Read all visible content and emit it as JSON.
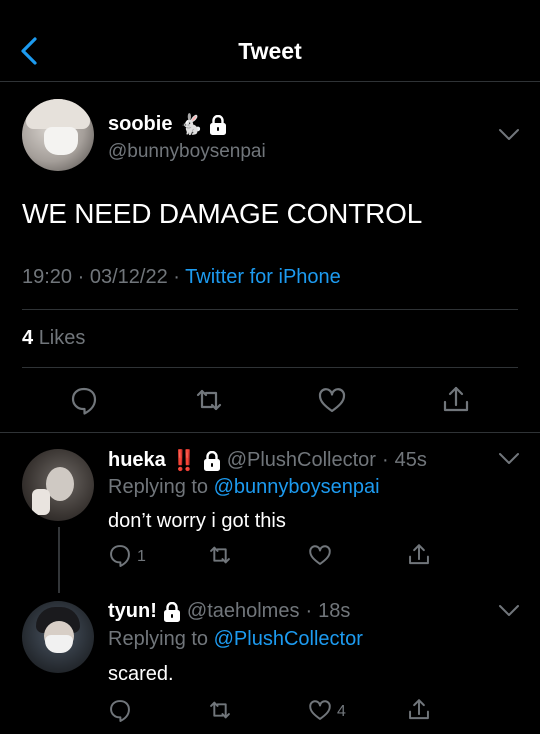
{
  "header": {
    "title": "Tweet"
  },
  "main_tweet": {
    "name": "soobie",
    "name_emoji": "🐇",
    "handle": "@bunnyboysenpai",
    "text": "WE NEED DAMAGE CONTROL",
    "time": "19:20",
    "date": "03/12/22",
    "separator": "·",
    "source": "Twitter for iPhone",
    "likes_count": "4",
    "likes_label": "Likes"
  },
  "replies": [
    {
      "name": "hueka",
      "name_emoji": "‼️",
      "handle": "@PlushCollector",
      "time": "45s",
      "separator": "·",
      "replying_prefix": "Replying to",
      "replying_to": "@bunnyboysenpai",
      "text": "don’t worry i got this",
      "reply_count": "1",
      "like_count": ""
    },
    {
      "name": "tyun!",
      "name_emoji": "",
      "handle": "@taeholmes",
      "time": "18s",
      "separator": "·",
      "replying_prefix": "Replying to",
      "replying_to": "@PlushCollector",
      "text": "scared.",
      "reply_count": "",
      "like_count": "4"
    }
  ],
  "icons": {
    "back": "chevron-left-icon",
    "lock": "lock-icon",
    "reply": "speech-bubble-icon",
    "retweet": "retweet-icon",
    "like": "heart-icon",
    "share": "share-icon",
    "more": "chevron-down-icon"
  },
  "colors": {
    "accent": "#1d9bf0",
    "muted": "#71767b",
    "background": "#000000",
    "divider": "#2f3336"
  }
}
